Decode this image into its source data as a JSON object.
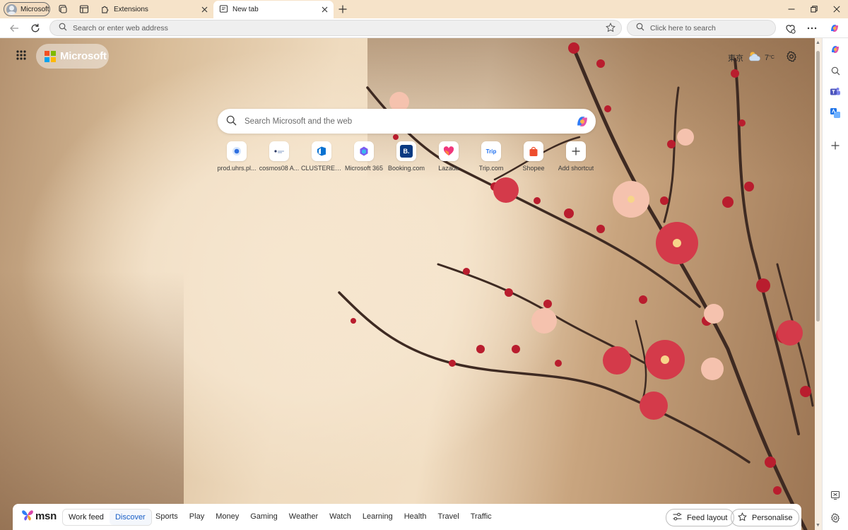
{
  "browser": {
    "profile_label": "Microsoft",
    "tabs": [
      {
        "title": "Extensions",
        "active": false
      },
      {
        "title": "New tab",
        "active": true
      }
    ],
    "address_placeholder": "Search or enter web address",
    "web_search_placeholder": "Click here to search"
  },
  "ntp": {
    "brand_label": "Microsoft",
    "weather": {
      "city": "東京",
      "temperature": "7",
      "unit": "°C"
    },
    "search_placeholder": "Search Microsoft and the web",
    "shortcuts": [
      {
        "label": "prod.uhrs.pl...",
        "icon": "uhrs-icon"
      },
      {
        "label": "cosmos08 A...",
        "icon": "cosmos-icon"
      },
      {
        "label": "CLUSTERED ...",
        "icon": "azure-devops-icon"
      },
      {
        "label": "Microsoft 365",
        "icon": "microsoft-365-icon"
      },
      {
        "label": "Booking.com",
        "icon": "booking-icon"
      },
      {
        "label": "Lazada",
        "icon": "lazada-icon"
      },
      {
        "label": "Trip.com",
        "icon": "trip-icon"
      },
      {
        "label": "Shopee",
        "icon": "shopee-icon"
      },
      {
        "label": "Add shortcut",
        "icon": "plus-icon"
      }
    ],
    "tile_text": {
      "booking": "B.",
      "trip": "Trip"
    }
  },
  "msn": {
    "logo_text": "msn",
    "feed_options": [
      {
        "label": "Work feed",
        "selected": false
      },
      {
        "label": "Discover",
        "selected": true
      }
    ],
    "nav_items": [
      "Sports",
      "Play",
      "Money",
      "Gaming",
      "Weather",
      "Watch",
      "Learning",
      "Health",
      "Travel",
      "Traffic"
    ],
    "feed_layout_label": "Feed layout",
    "personalise_label": "Personalise"
  },
  "colors": {
    "accent": "#1a5fc7",
    "ms_red": "#f25022",
    "ms_green": "#7fba00",
    "ms_blue": "#00a4ef",
    "ms_yellow": "#ffb900"
  }
}
